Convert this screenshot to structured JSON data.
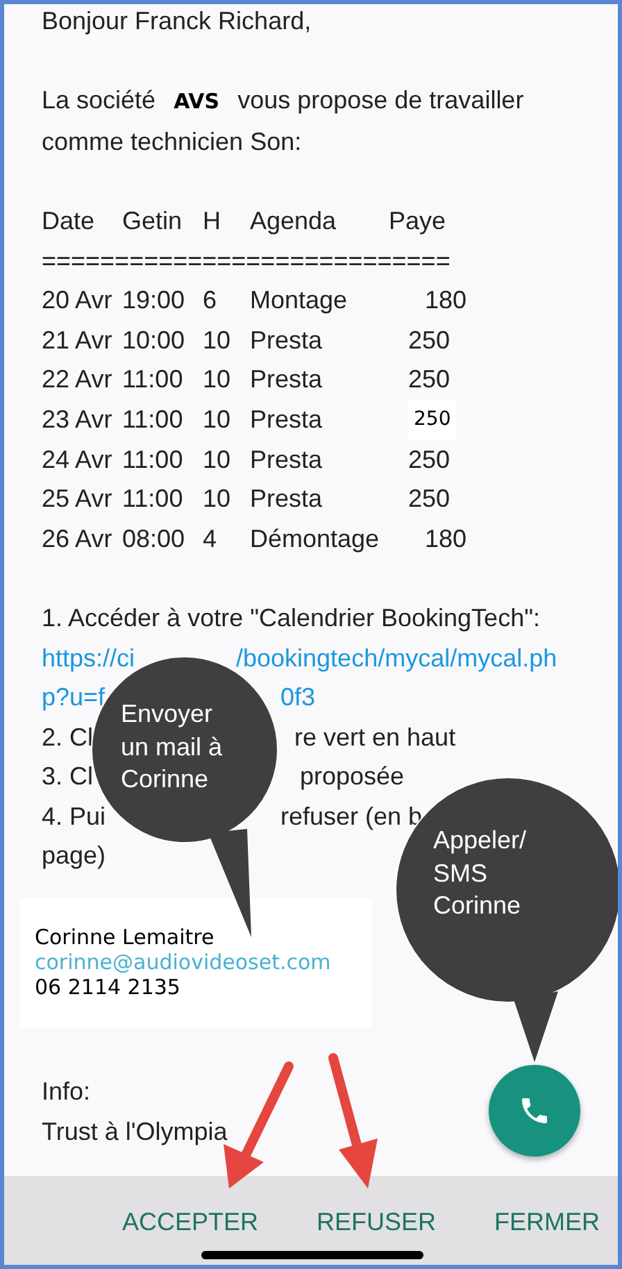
{
  "greeting": "Bonjour Franck Richard,",
  "intro": "La société **AVS** vous propose de travailler comme technicien Son:",
  "schedule": {
    "columns": [
      "Date",
      "Getin",
      "H",
      "Agenda",
      "Paye"
    ],
    "separator": "============================",
    "rows": [
      {
        "cells": [
          "20 Avr",
          "19:00",
          "6",
          "Montage",
          "180"
        ],
        "boxed": false
      },
      {
        "cells": [
          "21 Avr",
          "10:00",
          "10",
          "Presta",
          "250"
        ],
        "boxed": false
      },
      {
        "cells": [
          "22 Avr",
          "11:00",
          "10",
          "Presta",
          "250"
        ],
        "boxed": false
      },
      {
        "cells": [
          "23 Avr",
          "11:00",
          "10",
          "Presta",
          "250"
        ],
        "boxed": true
      },
      {
        "cells": [
          "24 Avr",
          "11:00",
          "10",
          "Presta",
          "250"
        ],
        "boxed": false
      },
      {
        "cells": [
          "25 Avr",
          "11:00",
          "10",
          "Presta",
          "250"
        ],
        "boxed": false
      },
      {
        "cells": [
          "26 Avr",
          "08:00",
          "4",
          "Démontage",
          "180"
        ],
        "boxed": false
      }
    ]
  },
  "instructions": [
    {
      "kind": "text",
      "fragments": [
        "1. Accéder à votre \"Calendrier BookingTech\":"
      ]
    },
    {
      "kind": "link",
      "fragments": [
        "https://ci",
        "/bookingtech/mycal/mycal.ph"
      ]
    },
    {
      "kind": "link",
      "fragments": [
        "p?u=f",
        "0f3"
      ]
    },
    {
      "kind": "text",
      "fragments": [
        "2. Cl",
        "re vert en haut"
      ]
    },
    {
      "kind": "text",
      "fragments": [
        "3. Cl",
        "proposée"
      ]
    },
    {
      "kind": "text",
      "fragments": [
        "4. Pui",
        "refuser (en b"
      ]
    },
    {
      "kind": "text",
      "fragments": [
        "page)"
      ]
    }
  ],
  "contact": {
    "name": "Corinne Lemaitre",
    "email": "corinne@audiovideoset.com",
    "phone": "06 2114 2135"
  },
  "info": {
    "label": "Info:",
    "text": "Trust à l'Olympia"
  },
  "callouts": [
    {
      "lines": [
        "Envoyer",
        "un mail à",
        "Corinne"
      ]
    },
    {
      "lines": [
        "Appeler/",
        "SMS",
        "Corinne"
      ]
    }
  ],
  "actions": [
    "ACCEPTER",
    "REFUSER",
    "FERMER"
  ]
}
